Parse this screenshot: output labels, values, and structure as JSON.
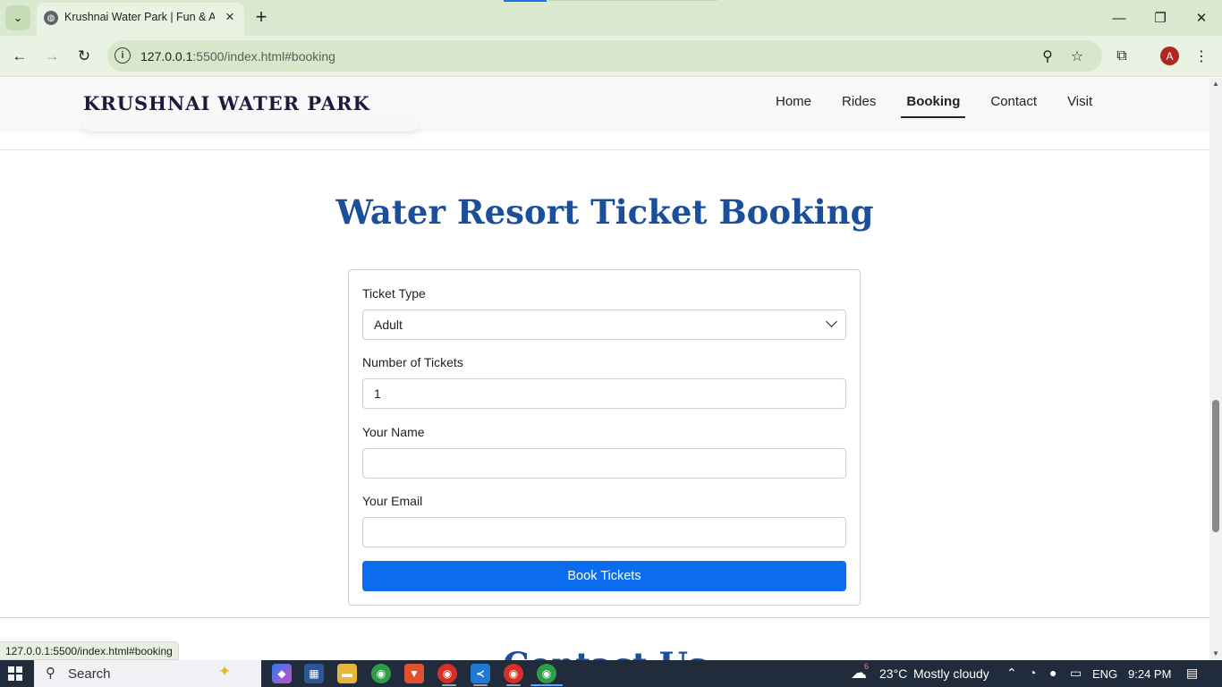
{
  "browser": {
    "tab_title": "Krushnai Water Park | Fun & Adventure",
    "url_host": "127.0.0.1",
    "url_rest": ":5500/index.html#booking",
    "status_url": "127.0.0.1:5500/index.html#booking",
    "avatar_letter": "A"
  },
  "site": {
    "brand": "KRUSHNAI WATER PARK",
    "nav": [
      {
        "label": "Home",
        "active": false
      },
      {
        "label": "Rides",
        "active": false
      },
      {
        "label": "Booking",
        "active": true
      },
      {
        "label": "Contact",
        "active": false
      },
      {
        "label": "Visit",
        "active": false
      }
    ]
  },
  "booking": {
    "title": "Water Resort Ticket Booking",
    "ticket_type_label": "Ticket Type",
    "ticket_type_value": "Adult",
    "num_tickets_label": "Number of Tickets",
    "num_tickets_value": "1",
    "name_label": "Your Name",
    "name_value": "",
    "email_label": "Your Email",
    "email_value": "",
    "submit_label": "Book Tickets"
  },
  "next_section": {
    "title": "Contact Us"
  },
  "taskbar": {
    "search_label": "Search",
    "weather_temp": "23°C",
    "weather_desc": "Mostly cloudy",
    "weather_badge": "6",
    "language": "ENG",
    "time": "9:24 PM"
  },
  "colors": {
    "heading": "#1b4f9a",
    "button": "#0b6cf0",
    "chrome": "#d9e8cf",
    "taskbar": "#202b3c"
  }
}
